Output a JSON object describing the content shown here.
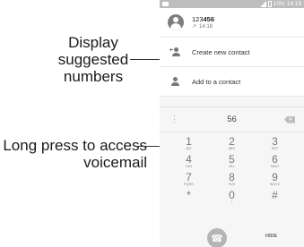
{
  "callouts": {
    "top": "Display suggested numbers",
    "bottom": "Long press to access voicemail"
  },
  "status_bar": {
    "battery": "10%",
    "time": "14:19"
  },
  "suggestion": {
    "number_prefix": "123",
    "number_match": "456",
    "call_direction": "↗",
    "time": "14:18"
  },
  "actions": {
    "create_new_contact": "Create new contact",
    "add_to_contact": "Add to a contact"
  },
  "dialpad": {
    "overflow": "⋮",
    "digits": "56",
    "backspace": "✕",
    "keys": [
      {
        "num": "1",
        "letters": "QO"
      },
      {
        "num": "2",
        "letters": "ABC"
      },
      {
        "num": "3",
        "letters": "DEF"
      },
      {
        "num": "4",
        "letters": "GHI"
      },
      {
        "num": "5",
        "letters": "JKL"
      },
      {
        "num": "6",
        "letters": "MNO"
      },
      {
        "num": "7",
        "letters": "PQRS"
      },
      {
        "num": "8",
        "letters": "TUV"
      },
      {
        "num": "9",
        "letters": "WXYZ"
      },
      {
        "num": "*",
        "letters": ""
      },
      {
        "num": "0",
        "letters": "+"
      },
      {
        "num": "#",
        "letters": ""
      }
    ],
    "call_icon": "☎",
    "hide_label": "HIDE"
  },
  "colors": {
    "panel": "#f6f6f6",
    "accent_gray": "#b5b5b5"
  }
}
